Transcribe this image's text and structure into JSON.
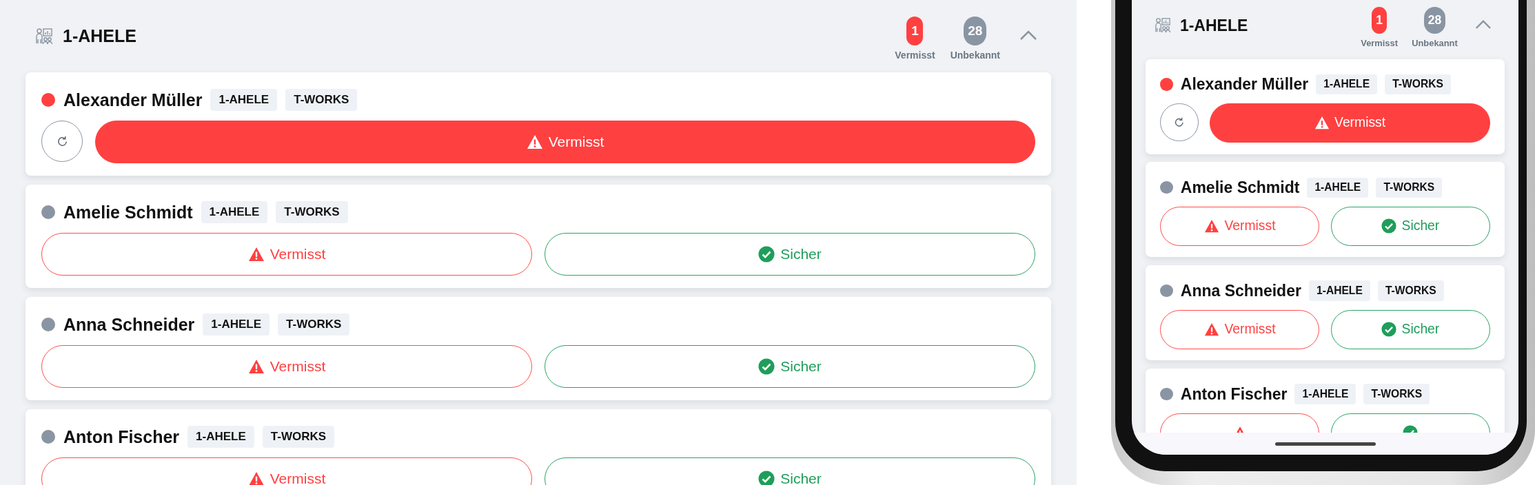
{
  "desktop_view": {
    "group": {
      "title": "1-AHELE",
      "expanded": true,
      "counters": [
        {
          "count": "1",
          "label": "Vermisst",
          "color": "#ff4040"
        },
        {
          "count": "28",
          "label": "Unbekannt",
          "color": "#8a95a3"
        }
      ]
    },
    "people": [
      {
        "name": "Alexander Müller",
        "color": "#ff4040",
        "tags": [
          "1-AHELE",
          "T-WORKS"
        ],
        "actions": [
          {
            "kind": "reset"
          },
          {
            "kind": "missing",
            "label": "Vermisst",
            "selected": true
          }
        ]
      },
      {
        "name": "Amelie Schmidt",
        "color": "#8a95a3",
        "tags": [
          "1-AHELE",
          "T-WORKS"
        ],
        "actions": [
          {
            "kind": "missing",
            "label": "Vermisst",
            "selected": false
          },
          {
            "kind": "safe",
            "label": "Sicher",
            "selected": false
          }
        ]
      },
      {
        "name": "Anna Schneider",
        "color": "#8a95a3",
        "tags": [
          "1-AHELE",
          "T-WORKS"
        ],
        "actions": [
          {
            "kind": "missing",
            "label": "Vermisst",
            "selected": false
          },
          {
            "kind": "safe",
            "label": "Sicher",
            "selected": false
          }
        ]
      },
      {
        "name": "Anton Fischer",
        "color": "#8a95a3",
        "tags": [
          "1-AHELE",
          "T-WORKS"
        ],
        "actions": [
          {
            "kind": "missing",
            "label": "Vermisst",
            "selected": false
          },
          {
            "kind": "safe",
            "label": "Sicher",
            "selected": false
          }
        ]
      }
    ]
  },
  "mobile_preview": {
    "group": {
      "title": "1-AHELE",
      "expanded": true,
      "counters": [
        {
          "count": "1",
          "label": "Vermisst",
          "color": "#ff4040"
        },
        {
          "count": "28",
          "label": "Unbekannt",
          "color": "#8a95a3"
        }
      ]
    },
    "people": [
      {
        "name": "Alexander Müller",
        "color": "#ff4040",
        "tags": [
          "1-AHELE",
          "T-WORKS"
        ],
        "actions": [
          {
            "kind": "reset"
          },
          {
            "kind": "missing",
            "label": "Vermisst",
            "selected": true
          }
        ]
      },
      {
        "name": "Amelie Schmidt",
        "color": "#8a95a3",
        "tags": [
          "1-AHELE",
          "T-WORKS"
        ],
        "actions": [
          {
            "kind": "missing",
            "label": "Vermisst",
            "selected": false
          },
          {
            "kind": "safe",
            "label": "Sicher",
            "selected": false
          }
        ]
      },
      {
        "name": "Anna Schneider",
        "color": "#8a95a3",
        "tags": [
          "1-AHELE",
          "T-WORKS"
        ],
        "actions": [
          {
            "kind": "missing",
            "label": "Vermisst",
            "selected": false
          },
          {
            "kind": "safe",
            "label": "Sicher",
            "selected": false
          }
        ]
      },
      {
        "name": "Anton Fischer",
        "color": "#8a95a3",
        "tags": [
          "1-AHELE",
          "T-WORKS"
        ],
        "actions": [
          {
            "kind": "missing",
            "selected": false
          },
          {
            "kind": "safe",
            "selected": false
          }
        ]
      }
    ]
  }
}
